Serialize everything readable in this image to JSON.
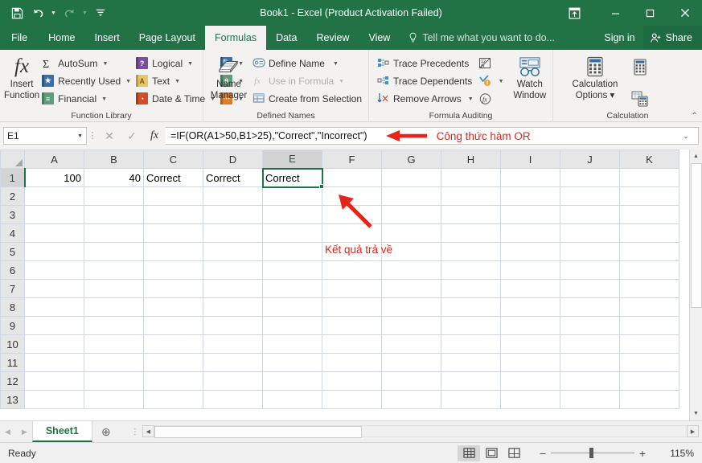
{
  "titlebar": {
    "document_title": "Book1 - Excel (Product Activation Failed)",
    "qat": [
      {
        "name": "save",
        "glyph": "ὋE"
      },
      {
        "name": "undo",
        "glyph": "↶"
      },
      {
        "name": "redo",
        "glyph": "↷"
      },
      {
        "name": "customize",
        "glyph": "≡"
      }
    ],
    "ribbon_display_options": "Ribbon Display Options",
    "minimize": "–",
    "maximize": "☐",
    "close": "✕"
  },
  "ribbon_tabs": [
    {
      "label": "File",
      "active": false
    },
    {
      "label": "Home",
      "active": false
    },
    {
      "label": "Insert",
      "active": false
    },
    {
      "label": "Page Layout",
      "active": false
    },
    {
      "label": "Formulas",
      "active": true
    },
    {
      "label": "Data",
      "active": false
    },
    {
      "label": "Review",
      "active": false
    },
    {
      "label": "View",
      "active": false
    }
  ],
  "tellme": {
    "placeholder": "Tell me what you want to do..."
  },
  "account": {
    "signin": "Sign in",
    "share": "Share"
  },
  "ribbon": {
    "groups": [
      {
        "title": "Function Library",
        "big_button": {
          "label_line1": "Insert",
          "label_line2": "Function",
          "icon": "fx"
        },
        "col1": [
          {
            "label": "AutoSum",
            "caret": true,
            "icon": "sigma"
          },
          {
            "label": "Recently Used",
            "caret": true,
            "icon": "star-book"
          },
          {
            "label": "Financial",
            "caret": true,
            "icon": "financial-book"
          }
        ],
        "col2": [
          {
            "label": "Logical",
            "caret": true,
            "icon": "logical-book"
          },
          {
            "label": "Text",
            "caret": true,
            "icon": "text-book"
          },
          {
            "label": "Date & Time",
            "caret": true,
            "icon": "datetime-book"
          }
        ],
        "col3": [
          {
            "label": "",
            "caret": true,
            "icon": "lookup-reference-book"
          },
          {
            "label": "",
            "caret": true,
            "icon": "math-trig-book"
          },
          {
            "label": "",
            "caret": true,
            "icon": "more-functions-book"
          }
        ]
      },
      {
        "title": "Defined Names",
        "big_button": {
          "label_line1": "Name",
          "label_line2": "Manager",
          "icon": "name-manager"
        },
        "col1": [
          {
            "label": "Define Name",
            "caret": true,
            "icon": "define-name",
            "disabled": false
          },
          {
            "label": "Use in Formula",
            "caret": true,
            "icon": "use-in-formula",
            "disabled": true
          },
          {
            "label": "Create from Selection",
            "caret": false,
            "icon": "create-from-selection",
            "disabled": false
          }
        ]
      },
      {
        "title": "Formula Auditing",
        "col1": [
          {
            "label": "Trace Precedents",
            "caret": false,
            "icon": "trace-precedents"
          },
          {
            "label": "Trace Dependents",
            "caret": false,
            "icon": "trace-dependents"
          },
          {
            "label": "Remove Arrows",
            "caret": true,
            "icon": "remove-arrows"
          }
        ],
        "col2": [
          {
            "label": "",
            "caret": false,
            "icon": "show-formulas"
          },
          {
            "label": "",
            "caret": true,
            "icon": "error-checking"
          },
          {
            "label": "",
            "caret": false,
            "icon": "evaluate-formula"
          }
        ],
        "big_button": {
          "label_line1": "Watch",
          "label_line2": "Window",
          "icon": "watch-window"
        }
      },
      {
        "title": "Calculation",
        "big_button": {
          "label_line1": "Calculation",
          "label_line2": "Options ▾",
          "icon": "calculation-options"
        },
        "col2": [
          {
            "label": "",
            "caret": false,
            "icon": "calculate-now"
          },
          {
            "label": "",
            "caret": false,
            "icon": "calculate-sheet"
          }
        ]
      }
    ],
    "collapse_label": "⌃"
  },
  "formula_bar": {
    "name_box_value": "E1",
    "cancel": "✕",
    "enter": "✓",
    "insert_function": "fx",
    "formula": "=IF(OR(A1>50,B1>25),\"Correct\",\"Incorrect\")",
    "expand": "⌄",
    "annotation": "Công thức hàm OR"
  },
  "grid": {
    "columns": [
      "A",
      "B",
      "C",
      "D",
      "E",
      "F",
      "G",
      "H",
      "I",
      "J",
      "K"
    ],
    "selected_column": "E",
    "rows": [
      "1",
      "2",
      "3",
      "4",
      "5",
      "6",
      "7",
      "8",
      "9",
      "10",
      "11",
      "12",
      "13"
    ],
    "selected_row": "1",
    "selected_cell": "E1",
    "data": {
      "A1": "100",
      "B1": "40",
      "C1": "Correct",
      "D1": "Correct",
      "E1": "Correct"
    },
    "annotation": "Kết quả trả về"
  },
  "sheet_tabs": {
    "prev": "◀",
    "next": "▶",
    "tabs": [
      {
        "label": "Sheet1",
        "active": true
      }
    ],
    "add_sheet": "⊕"
  },
  "scrollbars": {
    "v_up": "▲",
    "v_down": "▼",
    "h_left": "◀",
    "h_right": "▶"
  },
  "status_bar": {
    "status": "Ready",
    "views": [
      {
        "name": "normal",
        "active": true
      },
      {
        "name": "page-layout",
        "active": false
      },
      {
        "name": "page-break-preview",
        "active": false
      }
    ],
    "zoom_out": "−",
    "zoom_in": "+",
    "zoom_level": "115%"
  },
  "colors": {
    "excel_green": "#217346",
    "ribbon_bg": "#f3f2f1",
    "annotation_red": "#e8231a",
    "grid_line": "#d0d7de"
  }
}
